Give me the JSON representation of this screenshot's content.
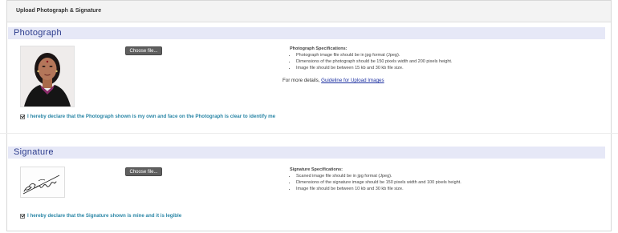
{
  "topbar": {
    "title": "Upload Photograph & Signature"
  },
  "photo": {
    "section_title": "Photograph",
    "choose_label": "Choose file...",
    "specs_title": "Photograph Specifications:",
    "specs": [
      "Photograph image file should be in jpg format (Jpeg).",
      "Dimensions of the photograph should be 150 pixels width and 200 pixels height.",
      "Image file should be between 15 kb and 30 kb file size."
    ],
    "more_details_prefix": "For more details,",
    "guideline_link": "Guideline for Upload Images",
    "declaration": "I hereby declare that the Photograph shown is my own and face on the Photograph is clear to identify me"
  },
  "signature": {
    "section_title": "Signature",
    "choose_label": "Choose file...",
    "specs_title": "Signature Specifications:",
    "specs": [
      "Scaned image file should be in jpg format (Jpeg).",
      "Dimensions of the signature image should be 150 pixels width and 100 pixels height.",
      "Image file should be between 10 kb and 30 kb file size."
    ],
    "declaration": "I hereby declare that the Signature shown is mine and it is legible"
  },
  "colors": {
    "section_header_bg": "#e6e8f7",
    "section_title": "#2a3a8c",
    "declaration_text": "#2a86a6",
    "link": "#1a2ea0",
    "button_bg": "#5f5f5f"
  }
}
